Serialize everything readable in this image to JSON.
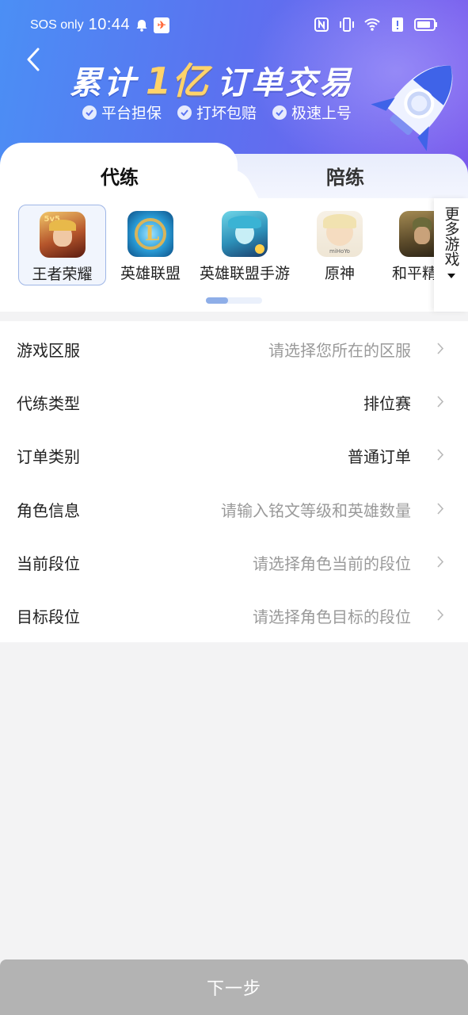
{
  "status_bar": {
    "carrier": "SOS only",
    "time": "10:44"
  },
  "banner": {
    "headline_part1": "累计",
    "headline_highlight": "1亿",
    "headline_part2": "订单交易",
    "features": [
      "平台担保",
      "打坏包赔",
      "极速上号"
    ],
    "colors": {
      "gradient_start": "#4b8ff5",
      "gradient_end": "#7a58ec",
      "highlight": "#ffd36a"
    }
  },
  "tabs": [
    {
      "label": "代练",
      "active": true
    },
    {
      "label": "陪练",
      "active": false
    }
  ],
  "games": [
    {
      "name": "王者荣耀",
      "icon": "honor-of-kings-icon",
      "selected": true
    },
    {
      "name": "英雄联盟",
      "icon": "league-of-legends-icon",
      "selected": false
    },
    {
      "name": "英雄联盟手游",
      "icon": "wild-rift-icon",
      "selected": false
    },
    {
      "name": "原神",
      "icon": "genshin-icon",
      "selected": false
    },
    {
      "name": "和平精英",
      "icon": "peace-elite-icon",
      "selected": false
    }
  ],
  "more_games": {
    "label": "更多游戏"
  },
  "pager": {
    "current_page": 1,
    "total_pages": 2
  },
  "form": {
    "rows": [
      {
        "label": "游戏区服",
        "value": "请选择您所在的区服",
        "is_placeholder": true
      },
      {
        "label": "代练类型",
        "value": "排位赛",
        "is_placeholder": false
      },
      {
        "label": "订单类别",
        "value": "普通订单",
        "is_placeholder": false
      },
      {
        "label": "角色信息",
        "value": "请输入铭文等级和英雄数量",
        "is_placeholder": true
      },
      {
        "label": "当前段位",
        "value": "请选择角色当前的段位",
        "is_placeholder": true
      },
      {
        "label": "目标段位",
        "value": "请选择角色目标的段位",
        "is_placeholder": true
      }
    ]
  },
  "next_button": {
    "label": "下一步",
    "enabled": false,
    "color": "#b3b3b3"
  }
}
